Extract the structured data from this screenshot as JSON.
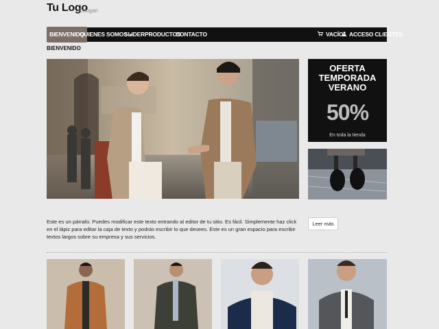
{
  "header": {
    "logo": "Tu Logo",
    "slogan": "Eslogan"
  },
  "nav": {
    "items": [
      {
        "label": "BIENVENIDO"
      },
      {
        "label": "QUIENES SOMOS"
      },
      {
        "label": "SLIDER"
      },
      {
        "label": "PRODUCTOS"
      },
      {
        "label": "CONTACTO"
      }
    ],
    "cart": "VACÍO",
    "login": "ACCESO CLIENTES"
  },
  "breadcrumb": "BIENVENIDO",
  "promo": {
    "line1": "OFERTA",
    "line2": "TEMPORADA",
    "line3": "VERANO",
    "percent": "50%",
    "sub": "En toda la tienda"
  },
  "content": {
    "paragraph": "Este es un párrafo. Puedes modificar este texto entrando al editor de tu sitio. Es fácil. Simplemente haz click en el lápiz para editar la caja de texto y podrás escribir lo que desees. Este es un gran espacio para escribir textos largos sobre su empresa y sus servicios.",
    "more_button": "Leer más"
  },
  "colors": {
    "nav_bg": "#111111",
    "nav_active": "#7a6e66",
    "page_bg": "#e9e9e9"
  },
  "icons": {
    "cart": "cart-icon",
    "login": "user-icon"
  }
}
